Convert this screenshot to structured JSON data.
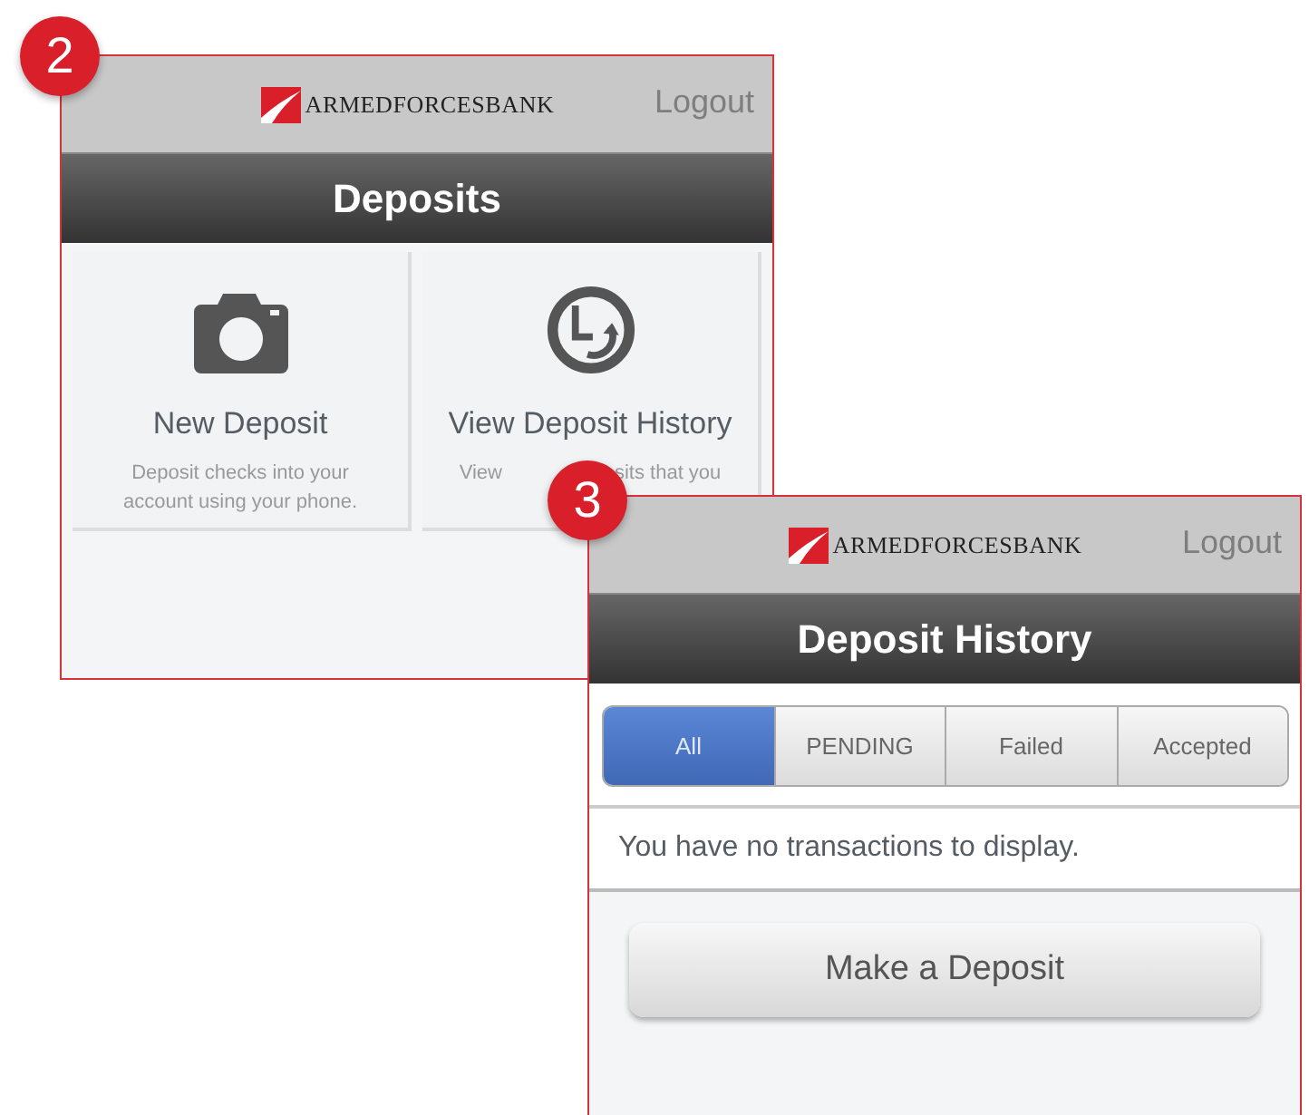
{
  "screens": [
    {
      "badge": "2",
      "logo": "ARMEDFORCESBANK",
      "logout": "Logout",
      "title": "Deposits",
      "kind": "menu",
      "cards": [
        {
          "kind": "camera",
          "title": "New Deposit",
          "description_lines": [
            [
              "Deposit checks into your"
            ],
            [
              "account using your phone."
            ]
          ]
        },
        {
          "kind": "clock",
          "title": "View Deposit History",
          "description_lines": [
            [
              "View",
              "sits that you"
            ]
          ]
        }
      ]
    },
    {
      "badge": "3",
      "logo": "ARMEDFORCESBANK",
      "logout": "Logout",
      "title": "Deposit History",
      "kind": "history",
      "tabs": [
        {
          "label": "All",
          "selected": true
        },
        {
          "label": "PENDING",
          "selected": false
        },
        {
          "label": "Failed",
          "selected": false
        },
        {
          "label": "Accepted",
          "selected": false
        }
      ],
      "message": "You have no transactions to display.",
      "button": "Make a Deposit"
    }
  ]
}
